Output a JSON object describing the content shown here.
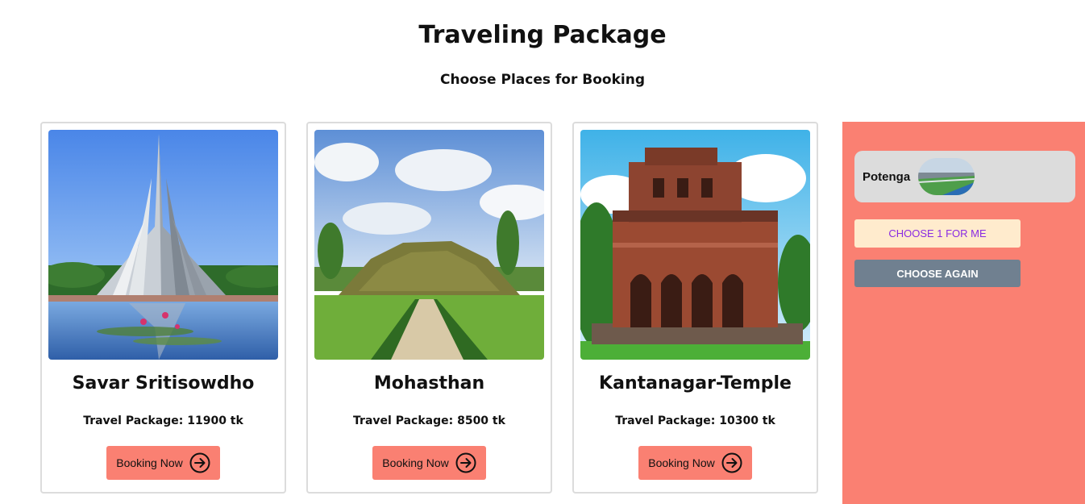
{
  "header": {
    "title": "Traveling Package",
    "subtitle": "Choose Places for Booking"
  },
  "cards": [
    {
      "name": "Savar Sritisowdho",
      "price_label": "Travel Package: 11900 tk",
      "button_label": "Booking Now",
      "image": "monument-photo"
    },
    {
      "name": "Mohasthan",
      "price_label": "Travel Package: 8500 tk",
      "button_label": "Booking Now",
      "image": "mound-ruins-photo"
    },
    {
      "name": "Kantanagar-Temple",
      "price_label": "Travel Package: 10300 tk",
      "button_label": "Booking Now",
      "image": "temple-photo"
    }
  ],
  "sidebar": {
    "selected": {
      "name": "Potenga",
      "image": "beach-thumbnail"
    },
    "choose_one_label": "Choose 1 for me",
    "choose_again_label": "Choose Again"
  },
  "colors": {
    "accent": "#fa8072",
    "chip_bg": "#dcdcdc",
    "choose_one_bg": "#ffebcd",
    "choose_one_text": "#8a2be2",
    "choose_again_bg": "#708090"
  },
  "icons": {
    "booking_button_icon": "arrow-right-circle-icon"
  }
}
